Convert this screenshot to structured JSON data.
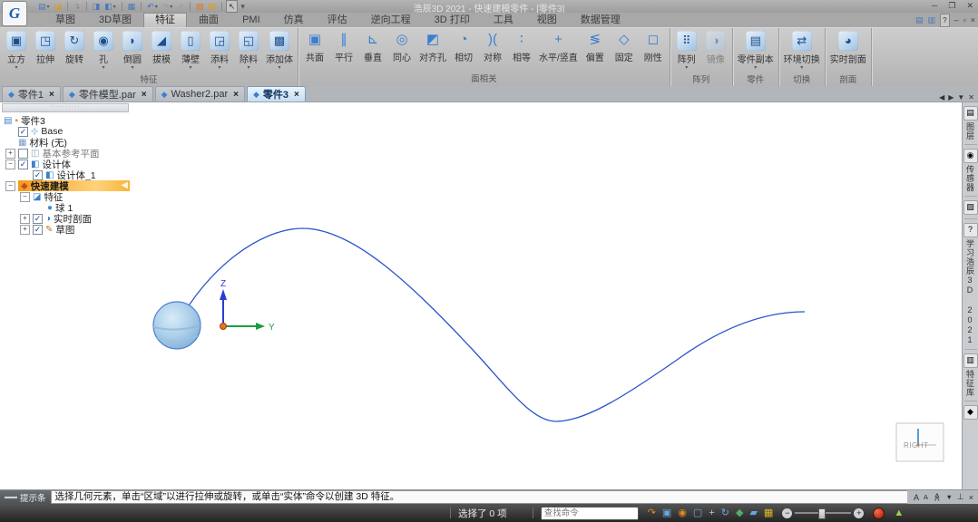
{
  "window": {
    "title": "浩辰3D 2021 - 快速建模零件 - [零件3]",
    "logo_letter": "G",
    "controls": [
      {
        "name": "minimize",
        "glyph": "─"
      },
      {
        "name": "maximize",
        "glyph": "❐"
      },
      {
        "name": "close",
        "glyph": "✕"
      }
    ]
  },
  "quick_access": [
    {
      "name": "new-document",
      "glyph": "▤",
      "color": "#4a78b8",
      "dropdown": true
    },
    {
      "name": "open",
      "glyph": "◪",
      "color": "#d89a30"
    },
    {
      "name": "import",
      "glyph": "↴",
      "color": "#7a8a98",
      "sep_before": true
    },
    {
      "name": "save",
      "glyph": "◨",
      "color": "#4a78b8",
      "sep_before": true
    },
    {
      "name": "save-as",
      "glyph": "◧",
      "color": "#4a78b8",
      "dropdown": true
    },
    {
      "name": "properties",
      "glyph": "▦",
      "color": "#4a78b8",
      "sep_before": true
    },
    {
      "name": "undo",
      "glyph": "↶",
      "color": "#3a6fd0",
      "dropdown": true,
      "sep_before": true
    },
    {
      "name": "redo",
      "glyph": "↷",
      "color": "#9a9a9a",
      "dropdown": true
    },
    {
      "name": "link",
      "glyph": "↗",
      "color": "#9a9a9a"
    },
    {
      "name": "style",
      "glyph": "▧",
      "color": "#d87a20",
      "sep_before": true
    },
    {
      "name": "themes",
      "glyph": "▨",
      "color": "#d8a020"
    },
    {
      "name": "select-tool",
      "glyph": "↖",
      "color": "#333333",
      "boxed": true,
      "sep_before": true
    },
    {
      "name": "qat-overflow",
      "glyph": "▾",
      "color": "#555555"
    }
  ],
  "menu": {
    "active": "特征",
    "tabs": [
      "草图",
      "3D草图",
      "特征",
      "曲面",
      "PMI",
      "仿真",
      "评估",
      "逆向工程",
      "3D 打印",
      "工具",
      "视图",
      "数据管理"
    ]
  },
  "doc_window_controls": [
    {
      "name": "cascade-windows",
      "glyph": "▤",
      "color": "#4a78b8"
    },
    {
      "name": "tile-windows",
      "glyph": "▥",
      "color": "#4a78b8"
    },
    {
      "name": "help",
      "glyph": "?",
      "color": "#333333",
      "boxed": true
    },
    {
      "name": "doc-minimize",
      "glyph": "–",
      "color": "#3c3c3c"
    },
    {
      "name": "doc-restore",
      "glyph": "▫",
      "color": "#3c3c3c"
    },
    {
      "name": "doc-close",
      "glyph": "×",
      "color": "#3c3c3c"
    }
  ],
  "ribbon": {
    "groups": [
      {
        "label": "特征",
        "style": "3d",
        "buttons": [
          {
            "label": "立方",
            "icon": "cube-icon",
            "glyph": "▣",
            "dropdown": true
          },
          {
            "label": "拉伸",
            "icon": "extrude-icon",
            "glyph": "◳"
          },
          {
            "label": "旋转",
            "icon": "revolve-icon",
            "glyph": "↻"
          },
          {
            "label": "孔",
            "icon": "hole-icon",
            "glyph": "◉",
            "dropdown": true
          },
          {
            "label": "倒圆",
            "icon": "round-icon",
            "glyph": "◗",
            "dropdown": true
          },
          {
            "label": "拔模",
            "icon": "draft-icon",
            "glyph": "◢"
          },
          {
            "label": "薄壁",
            "icon": "thin-wall-icon",
            "glyph": "▯",
            "dropdown": true
          },
          {
            "label": "添料",
            "icon": "add-material-icon",
            "glyph": "◲",
            "dropdown": true
          },
          {
            "label": "除料",
            "icon": "cut-material-icon",
            "glyph": "◱",
            "dropdown": true
          },
          {
            "label": "添加体",
            "icon": "add-body-icon",
            "glyph": "▩",
            "dropdown": true
          }
        ]
      },
      {
        "label": "面相关",
        "style": "flat",
        "buttons": [
          {
            "label": "共面",
            "icon": "coplanar-icon",
            "glyph": "▣"
          },
          {
            "label": "平行",
            "icon": "parallel-icon",
            "glyph": "∥"
          },
          {
            "label": "垂直",
            "icon": "perpendicular-icon",
            "glyph": "⊾"
          },
          {
            "label": "同心",
            "icon": "concentric-icon",
            "glyph": "◎"
          },
          {
            "label": "对齐孔",
            "icon": "align-holes-icon",
            "glyph": "◩"
          },
          {
            "label": "相切",
            "icon": "tangent-icon",
            "glyph": "◔"
          },
          {
            "label": "对称",
            "icon": "symmetric-icon",
            "glyph": ")("
          },
          {
            "label": "相等",
            "icon": "equal-icon",
            "glyph": "∶"
          },
          {
            "label": "水平/竖直",
            "icon": "horizontal-vertical-icon",
            "glyph": "+"
          },
          {
            "label": "偏置",
            "icon": "offset-icon",
            "glyph": "≶"
          },
          {
            "label": "固定",
            "icon": "ground-icon",
            "glyph": "◇"
          },
          {
            "label": "刚性",
            "icon": "rigid-icon",
            "glyph": "◻"
          }
        ]
      },
      {
        "label": "阵列",
        "style": "3d",
        "buttons": [
          {
            "label": "阵列",
            "icon": "pattern-icon",
            "glyph": "⠿",
            "dropdown": true
          },
          {
            "label": "镜像",
            "icon": "mirror-icon",
            "glyph": "◑",
            "disabled": true
          }
        ]
      },
      {
        "label": "零件",
        "style": "3d",
        "buttons": [
          {
            "label": "零件副本",
            "icon": "part-copy-icon",
            "glyph": "▤",
            "dropdown": true
          }
        ]
      },
      {
        "label": "切换",
        "style": "3d",
        "buttons": [
          {
            "label": "环境切换",
            "icon": "environment-switch-icon",
            "glyph": "⇄",
            "dropdown": true
          }
        ]
      },
      {
        "label": "剖面",
        "style": "3d",
        "buttons": [
          {
            "label": "实时剖面",
            "icon": "live-section-icon",
            "glyph": "◕"
          }
        ]
      }
    ]
  },
  "document_tabs": {
    "tabs": [
      {
        "label": "零件1",
        "active": false
      },
      {
        "label": "零件模型.par",
        "active": false
      },
      {
        "label": "Washer2.par",
        "active": false
      },
      {
        "label": "零件3",
        "active": true
      }
    ],
    "close_glyph": "×",
    "controls": [
      {
        "name": "scroll-tabs-left",
        "glyph": "◀"
      },
      {
        "name": "scroll-tabs-right",
        "glyph": "▶"
      },
      {
        "name": "tab-list",
        "glyph": "▼"
      },
      {
        "name": "close-document",
        "glyph": "✕"
      }
    ]
  },
  "tree": {
    "rows": [
      {
        "depth": 0,
        "icon": {
          "name": "part-document-icon",
          "glyph": "▤",
          "color": "#3a7fd0"
        },
        "icon2": {
          "name": "part-flag-icon",
          "glyph": "▪",
          "color": "#e09020"
        },
        "label": "零件3"
      },
      {
        "depth": 1,
        "check": true,
        "icon": {
          "name": "base-csys-icon",
          "glyph": "⊹",
          "color": "#3a7fd0"
        },
        "label": "Base"
      },
      {
        "depth": 1,
        "icon": {
          "name": "material-icon",
          "glyph": "▦",
          "color": "#7a9ac8"
        },
        "label": "材料 (无)"
      },
      {
        "depth": 1,
        "expand": "+",
        "check": false,
        "icon": {
          "name": "reference-planes-icon",
          "glyph": "◫",
          "color": "#8aa0b8"
        },
        "label": "基本参考平面",
        "muted": true
      },
      {
        "depth": 1,
        "expand": "−",
        "check": true,
        "icon": {
          "name": "design-body-icon",
          "glyph": "◧",
          "color": "#3a7fd0"
        },
        "label": "设计体"
      },
      {
        "depth": 2,
        "check": true,
        "icon": {
          "name": "design-body-icon",
          "glyph": "◧",
          "color": "#3a7fd0"
        },
        "label": "设计体_1"
      },
      {
        "depth": 1,
        "expand": "−",
        "highlight": true,
        "icon": {
          "name": "quick-modeling-icon",
          "glyph": "◆",
          "color": "#d0452a"
        },
        "label": "快速建模",
        "arrow": "◀"
      },
      {
        "depth": 2,
        "expand": "−",
        "icon": {
          "name": "features-icon",
          "glyph": "◪",
          "color": "#3a7fd0"
        },
        "label": "特征"
      },
      {
        "depth": 3,
        "icon": {
          "name": "sphere-feature-icon",
          "glyph": "●",
          "color": "#3a8fd8"
        },
        "label": "球 1"
      },
      {
        "depth": 2,
        "expand": "+",
        "check": true,
        "icon": {
          "name": "live-section-icon",
          "glyph": "◑",
          "color": "#3a7fd0"
        },
        "label": "实时剖面"
      },
      {
        "depth": 2,
        "expand": "+",
        "check": true,
        "icon": {
          "name": "sketch-icon",
          "glyph": "✎",
          "color": "#c07820"
        },
        "label": "草图"
      }
    ]
  },
  "right_panel": {
    "tabs": [
      {
        "name": "layers",
        "icon_glyph": "▤",
        "label": "图层"
      },
      {
        "name": "sensors",
        "icon_glyph": "◉",
        "label": "传感器"
      },
      {
        "name": "render-studio",
        "icon_glyph": "▨",
        "label": ""
      },
      {
        "name": "learn",
        "icon_glyph": "?",
        "label": "学习浩辰3D 2021"
      },
      {
        "name": "feature-library",
        "icon_glyph": "▥",
        "label": "特征库"
      },
      {
        "name": "parts-library",
        "icon_glyph": "◆",
        "label": ""
      }
    ]
  },
  "canvas": {
    "axis_labels": {
      "z": "Z",
      "y": "Y"
    },
    "view_indicator": "RIGHT",
    "curve_color": "#2a55cc",
    "sphere_outline": "#4a7fd4",
    "z_axis_color": "#2a3fd0",
    "y_axis_color": "#1a9e3a",
    "origin_color": "#e07820"
  },
  "prompt_bar": {
    "label": "提示条",
    "message": "选择几何元素，单击“区域”以进行拉伸或旋转，或单击“实体”命令以创建 3D 特征。",
    "icons": [
      {
        "name": "font-increase",
        "glyph": "A"
      },
      {
        "name": "font-decrease",
        "glyph": "A",
        "small": true
      },
      {
        "name": "collapse-prompt",
        "glyph": "≪",
        "rotate": true
      },
      {
        "name": "prompt-menu",
        "glyph": "▼",
        "small": true
      },
      {
        "name": "pin-prompt",
        "glyph": "⊥"
      },
      {
        "name": "close-prompt",
        "glyph": "×"
      }
    ]
  },
  "status_bar": {
    "selection": "选择了 0 项",
    "search_placeholder": "查找命令",
    "icons": [
      {
        "name": "previous-view",
        "glyph": "↷",
        "color": "#e0891e"
      },
      {
        "name": "zoom-area",
        "glyph": "▣",
        "color": "#6aa6e0"
      },
      {
        "name": "zoom",
        "glyph": "◉",
        "color": "#e0891e"
      },
      {
        "name": "fit-view",
        "glyph": "▢",
        "color": "#6aa6e0"
      },
      {
        "name": "pan",
        "glyph": "+",
        "color": "#b8c4d0"
      },
      {
        "name": "rotate-view",
        "glyph": "↻",
        "color": "#6aa6e0"
      },
      {
        "name": "named-views",
        "glyph": "◆",
        "color": "#4fae6a"
      },
      {
        "name": "view-styles",
        "glyph": "▰",
        "color": "#6aa6e0"
      },
      {
        "name": "window-layout",
        "glyph": "▦",
        "color": "#e0b62a"
      }
    ],
    "zoom_minus": "−",
    "zoom_plus": "+"
  }
}
